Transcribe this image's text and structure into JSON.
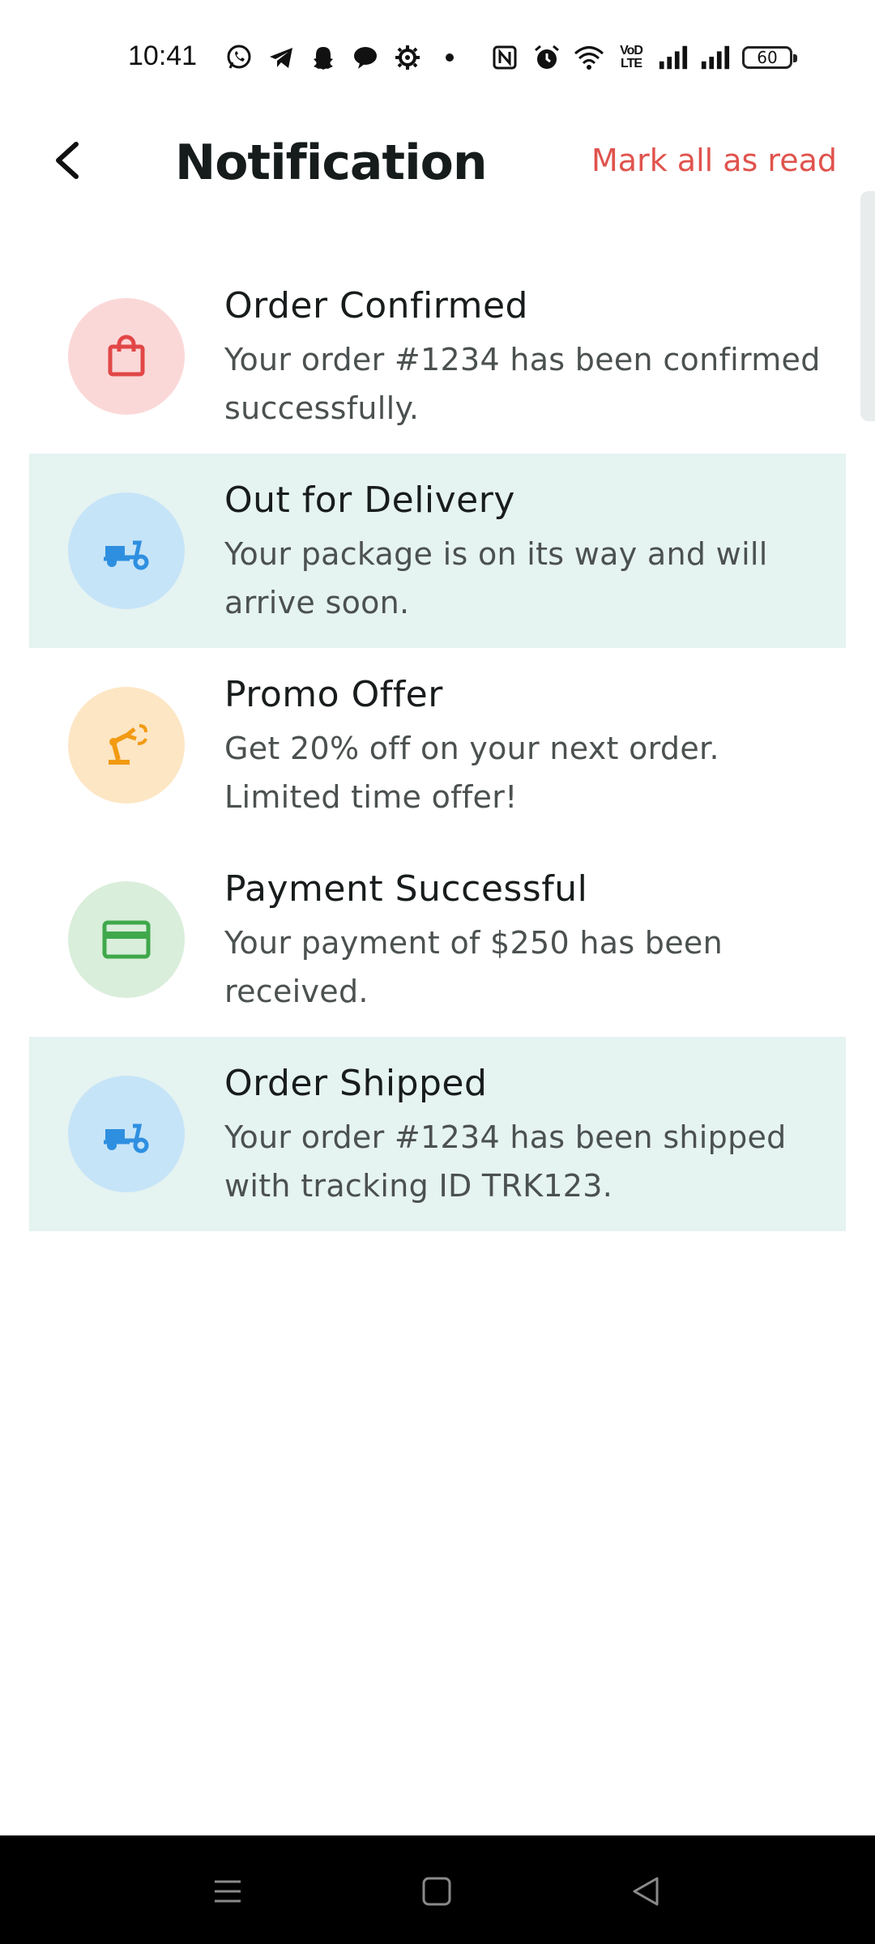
{
  "status_bar": {
    "time": "10:41",
    "volte_label": "VoD LTE",
    "battery": "60",
    "icons_left": [
      "whatsapp-icon",
      "telegram-icon",
      "snapchat-icon",
      "chat-bubble-icon",
      "settings-icon",
      "dot-icon"
    ],
    "icons_right": [
      "nfc-icon",
      "alarm-icon",
      "wifi-icon",
      "signal-icon",
      "signal-icon",
      "battery-icon"
    ]
  },
  "header": {
    "title": "Notification",
    "mark_all": "Mark all as read"
  },
  "notifications": [
    {
      "title": "Order Confirmed",
      "body": "Your order #1234 has been confirmed successfully.",
      "icon": "shopping-bag-icon",
      "unread": false
    },
    {
      "title": "Out for Delivery",
      "body": "Your package is on its way and will arrive soon.",
      "icon": "delivery-scooter-icon",
      "unread": true
    },
    {
      "title": "Promo Offer",
      "body": "Get 20% off on your next order. Limited time offer!",
      "icon": "promo-icon",
      "unread": false
    },
    {
      "title": "Payment Successful",
      "body": "Your payment of $250 has been received.",
      "icon": "credit-card-icon",
      "unread": false
    },
    {
      "title": "Order Shipped",
      "body": "Your order #1234 has been shipped with tracking ID TRK123.",
      "icon": "delivery-scooter-icon",
      "unread": true
    }
  ],
  "colors": {
    "accent_red": "#e0534d",
    "unread_bg": "#e5f3f1",
    "icon_red": "#e24747",
    "icon_blue": "#2e8fe0",
    "icon_orange": "#f29a12",
    "icon_green": "#3fa84b"
  },
  "nav_bar": {
    "buttons": [
      "menu-icon",
      "home-icon",
      "back-triangle-icon"
    ]
  }
}
